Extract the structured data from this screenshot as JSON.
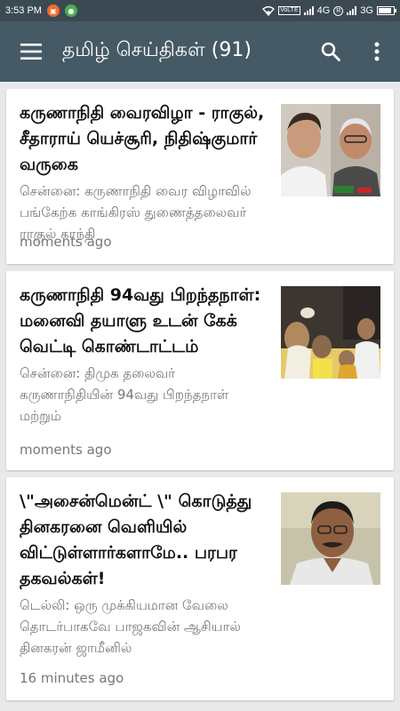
{
  "status_bar": {
    "time": "3:53 PM",
    "volte": "VoLTE",
    "r_tag": "R",
    "net1": "4G",
    "net2": "3G",
    "battery_level": 0.85
  },
  "app_bar": {
    "title": "தமிழ் செய்திகள் (91)"
  },
  "articles": [
    {
      "headline": "கருணாநிதி வைரவிழா - ராகுல், சீதாராய் யெச்சூரி, நிதிஷ்குமார் வருகை",
      "summary": "சென்னை: கருணாநிதி வைர விழாவில் பங்கேற்க காங்கிரஸ் துணைத்தலைவர் ராகுல் காந்தி",
      "time": "moments ago"
    },
    {
      "headline": "கருணாநிதி 94வது பிறந்தநாள்: மனைவி தயாளு உடன் கேக் வெட்டி கொண்டாட்டம்",
      "summary": "சென்னை: திமுக தலைவர் கருணாநிதியின் 94வது பிறந்தநாள் மற்றும்",
      "time": "moments ago"
    },
    {
      "headline": "\\\"அசைன்மென்ட் \\\" கொடுத்து தினகரனை வெளியில் விட்டுள்ளார்களாமே.. பரபர தகவல்கள்!",
      "summary": "டெல்லி: ஒரு முக்கியமான வேலை தொடர்பாகவே பாஜகவின் ஆசியால் தினகரன் ஜாமீனில்",
      "time": "16 minutes ago"
    }
  ]
}
